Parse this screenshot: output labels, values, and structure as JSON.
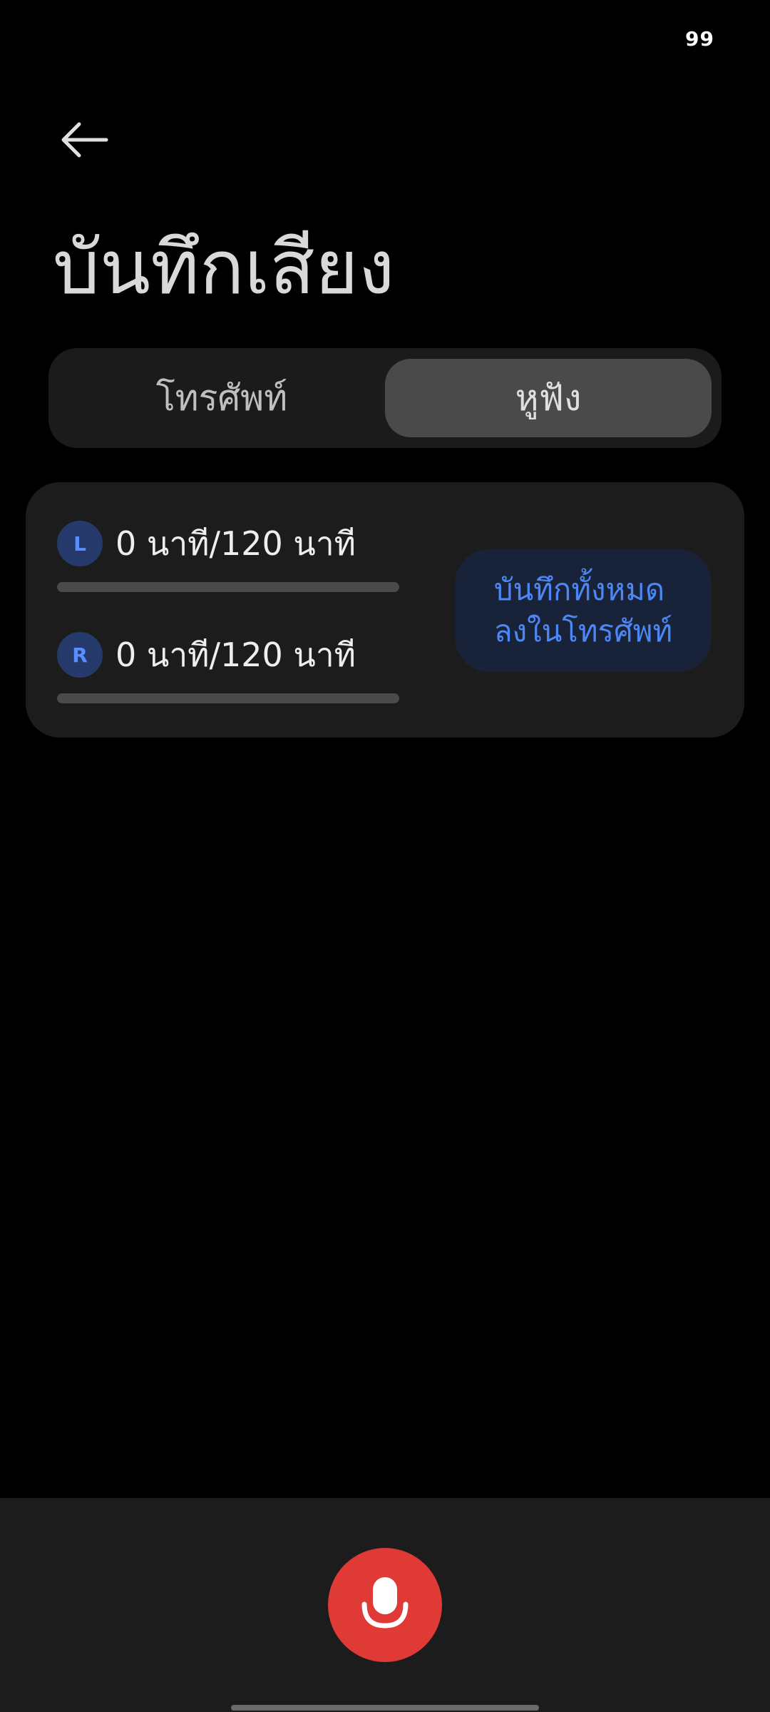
{
  "status_bar": {
    "battery": "99"
  },
  "header": {
    "title": "บันทึกเสียง"
  },
  "tabs": [
    {
      "label": "โทรศัพท์",
      "active": false
    },
    {
      "label": "หูฟัง",
      "active": true
    }
  ],
  "card": {
    "channels": [
      {
        "badge": "L",
        "time": "0 นาที/120 นาที",
        "progress": 0
      },
      {
        "badge": "R",
        "time": "0 นาที/120 นาที",
        "progress": 0
      }
    ],
    "save_all_label": "บันทึกทั้งหมด\nลงในโทรศัพท์"
  },
  "icons": {
    "back": "arrow-left-icon",
    "record": "microphone-icon"
  },
  "colors": {
    "accent": "#4d86f5",
    "record": "#e03a36"
  }
}
